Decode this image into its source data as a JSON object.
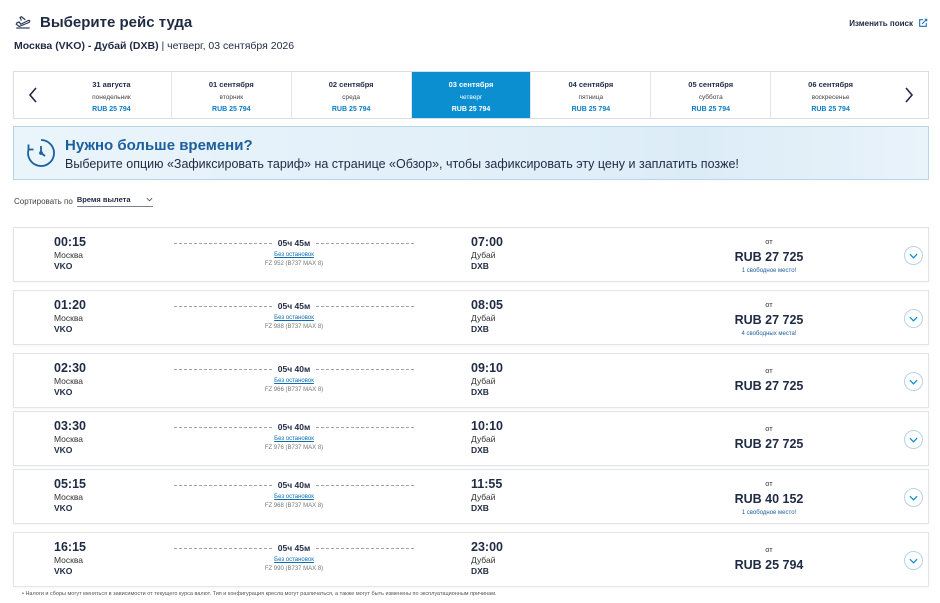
{
  "header": {
    "title": "Выберите рейс туда",
    "change_search": "Изменить поиск",
    "route_bold": "Москва (VKO) - Дубай (DXB)",
    "route_date": " | четверг, 03 сентября 2026"
  },
  "dates": [
    {
      "date": "31 августа",
      "weekday": "понедельник",
      "price": "RUB 25 794",
      "active": false
    },
    {
      "date": "01 сентября",
      "weekday": "вторник",
      "price": "RUB 25 794",
      "active": false
    },
    {
      "date": "02 сентября",
      "weekday": "среда",
      "price": "RUB 25 794",
      "active": false
    },
    {
      "date": "03 сентября",
      "weekday": "четверг",
      "price": "RUB 25 794",
      "active": true
    },
    {
      "date": "04 сентября",
      "weekday": "пятница",
      "price": "RUB 25 794",
      "active": false
    },
    {
      "date": "05 сентября",
      "weekday": "суббота",
      "price": "RUB 25 794",
      "active": false
    },
    {
      "date": "06 сентября",
      "weekday": "воскресенье",
      "price": "RUB 25 794",
      "active": false
    }
  ],
  "banner": {
    "title": "Нужно больше времени?",
    "text": "Выберите опцию «Зафиксировать тариф» на странице «Обзор», чтобы зафиксировать эту цену и заплатить позже!"
  },
  "sort": {
    "label": "Сортировать по",
    "value": "Время вылета"
  },
  "flights": [
    {
      "dep_time": "00:15",
      "dep_city": "Москва",
      "dep_code": "VKO",
      "duration": "05ч 45м",
      "stops": "Без остановок",
      "flight_no": "FZ 952 (B737 MAX 8)",
      "arr_time": "07:00",
      "arr_city": "Дубай",
      "arr_code": "DXB",
      "price_prefix": "от",
      "price": "RUB 27 725",
      "seats": "1 свободное место!"
    },
    {
      "dep_time": "01:20",
      "dep_city": "Москва",
      "dep_code": "VKO",
      "duration": "05ч 45м",
      "stops": "Без остановок",
      "flight_no": "FZ 988 (B737 MAX 8)",
      "arr_time": "08:05",
      "arr_city": "Дубай",
      "arr_code": "DXB",
      "price_prefix": "от",
      "price": "RUB 27 725",
      "seats": "4 свободных места!"
    },
    {
      "dep_time": "02:30",
      "dep_city": "Москва",
      "dep_code": "VKO",
      "duration": "05ч 40м",
      "stops": "Без остановок",
      "flight_no": "FZ 966 (B737 MAX 8)",
      "arr_time": "09:10",
      "arr_city": "Дубай",
      "arr_code": "DXB",
      "price_prefix": "от",
      "price": "RUB 27 725",
      "seats": ""
    },
    {
      "dep_time": "03:30",
      "dep_city": "Москва",
      "dep_code": "VKO",
      "duration": "05ч 40м",
      "stops": "Без остановок",
      "flight_no": "FZ 976 (B737 MAX 8)",
      "arr_time": "10:10",
      "arr_city": "Дубай",
      "arr_code": "DXB",
      "price_prefix": "от",
      "price": "RUB 27 725",
      "seats": ""
    },
    {
      "dep_time": "05:15",
      "dep_city": "Москва",
      "dep_code": "VKO",
      "duration": "05ч 40м",
      "stops": "Без остановок",
      "flight_no": "FZ 968 (B737 MAX 8)",
      "arr_time": "11:55",
      "arr_city": "Дубай",
      "arr_code": "DXB",
      "price_prefix": "от",
      "price": "RUB 40 152",
      "seats": "1 свободное место!"
    },
    {
      "dep_time": "16:15",
      "dep_city": "Москва",
      "dep_code": "VKO",
      "duration": "05ч 45м",
      "stops": "Без остановок",
      "flight_no": "FZ 990 (B737 MAX 8)",
      "arr_time": "23:00",
      "arr_city": "Дубай",
      "arr_code": "DXB",
      "price_prefix": "от",
      "price": "RUB 25 794",
      "seats": ""
    }
  ],
  "footnote": "• Налоги и сборы могут меняться в зависимости от текущего курса валют. Тип и конфигурация кресла могут различаться, а также могут быть изменены по эксплуатационным причинам.",
  "colors": {
    "active_date": "#0b8fd1",
    "price_link": "#0a7bc2",
    "banner_title": "#1c5f9c",
    "text_dark": "#1f2a44"
  },
  "icons": {
    "header": "plane-takeoff-icon",
    "change_search": "edit-icon",
    "prev": "chevron-left-icon",
    "next": "chevron-right-icon",
    "banner": "clock-icon",
    "sort": "chevron-down-icon",
    "expand": "chevron-down-icon"
  }
}
